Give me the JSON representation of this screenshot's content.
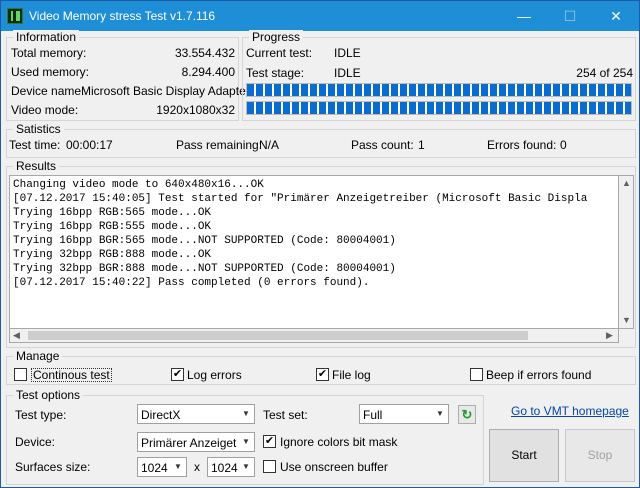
{
  "window": {
    "title": "Video Memory stress Test v1.7.116",
    "minimize": "—",
    "maximize": "☐",
    "close": "✕"
  },
  "information": {
    "title": "Information",
    "rows": [
      {
        "label": "Total memory:",
        "value": "33.554.432"
      },
      {
        "label": "Used memory:",
        "value": "8.294.400"
      },
      {
        "label": "Device name:",
        "value": "Microsoft Basic Display Adapter"
      },
      {
        "label": "Video mode:",
        "value": "1920x1080x32"
      }
    ]
  },
  "progress": {
    "title": "Progress",
    "current_test_label": "Current test:",
    "current_test_value": "IDLE",
    "test_stage_label": "Test stage:",
    "test_stage_value": "IDLE",
    "stage_count": "254 of 254",
    "bar1_fraction": 1.0,
    "bar2_fraction": 1.0
  },
  "statistics": {
    "title": "Satistics",
    "test_time_label": "Test time:",
    "test_time_value": "00:00:17",
    "pass_remaining_label": "Pass remaining:",
    "pass_remaining_value": "N/A",
    "pass_count_label": "Pass count:",
    "pass_count_value": "1",
    "errors_found_label": "Errors found:",
    "errors_found_value": "0"
  },
  "results": {
    "title": "Results",
    "lines": [
      "Changing video mode to 640x480x16...OK",
      "[07.12.2017 15:40:05] Test started for \"Primärer Anzeigetreiber (Microsoft Basic Displa",
      "Trying 16bpp RGB:565 mode...OK",
      "Trying 16bpp RGB:555 mode...OK",
      "Trying 16bpp BGR:565 mode...NOT SUPPORTED (Code: 80004001)",
      "Trying 32bpp RGB:888 mode...OK",
      "Trying 32bpp BGR:888 mode...NOT SUPPORTED (Code: 80004001)",
      "[07.12.2017 15:40:22] Pass completed (0 errors found)."
    ]
  },
  "manage": {
    "title": "Manage",
    "continuous_test": {
      "label": "Continous test",
      "checked": false
    },
    "log_errors": {
      "label": "Log errors",
      "checked": true
    },
    "file_log": {
      "label": "File log",
      "checked": true
    },
    "beep_if_errors": {
      "label": "Beep if errors found",
      "checked": false
    }
  },
  "test_options": {
    "title": "Test options",
    "test_type_label": "Test type:",
    "test_type_value": "DirectX",
    "test_set_label": "Test set:",
    "test_set_value": "Full",
    "device_label": "Device:",
    "device_value": "Primärer Anzeigetrei",
    "ignore_colors": {
      "label": "Ignore colors bit mask",
      "checked": true
    },
    "surfaces_label": "Surfaces size:",
    "surface_w": "1024",
    "surface_x": "x",
    "surface_h": "1024",
    "onscreen_buffer": {
      "label": "Use onscreen buffer",
      "checked": false
    }
  },
  "actions": {
    "homepage_link": "Go to VMT homepage",
    "start": "Start",
    "stop": "Stop"
  },
  "glyphs": {
    "check": "✔",
    "dropdown": "▼",
    "refresh": "↻",
    "left": "◀",
    "right": "▶",
    "up": "▲",
    "down": "▼"
  }
}
